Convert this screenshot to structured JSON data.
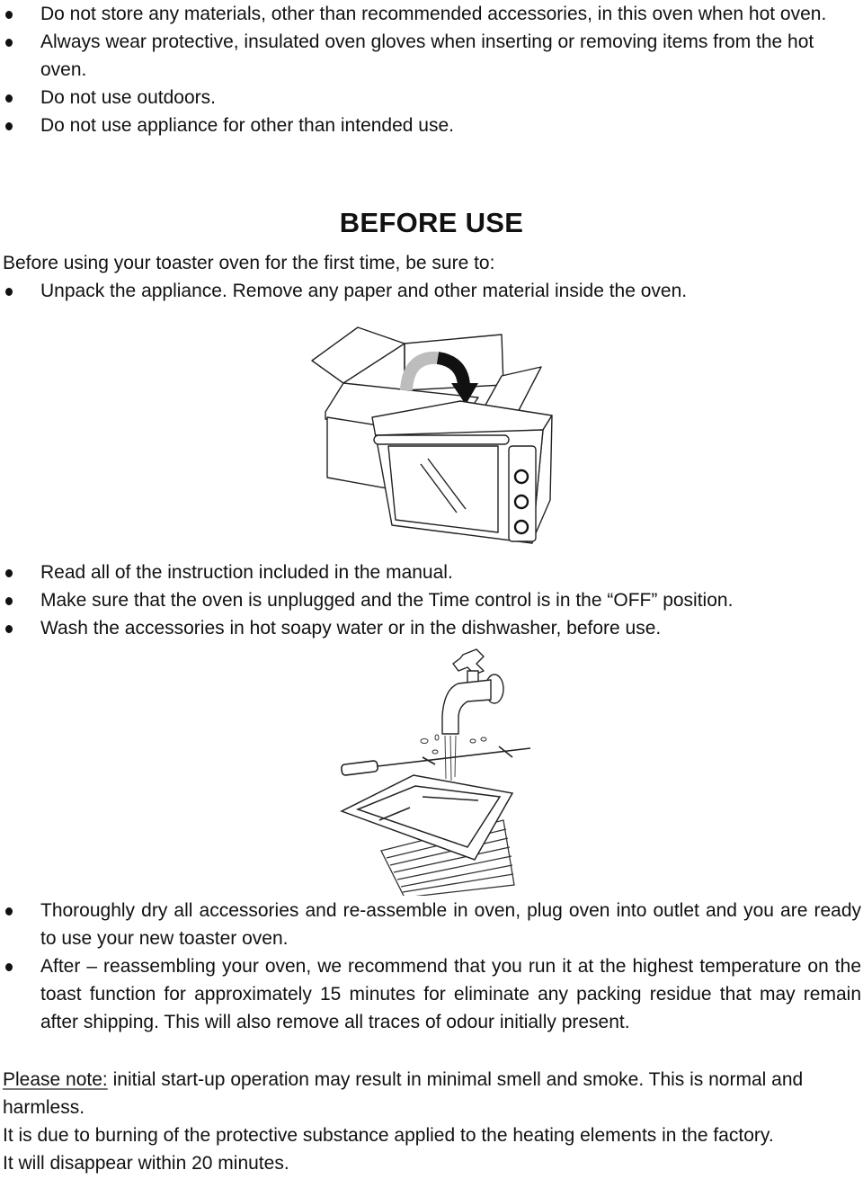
{
  "safety_bullets": [
    "Do not store any materials, other than recommended accessories, in this oven when hot oven.",
    "Always wear protective, insulated oven gloves when inserting or removing items from the hot oven.",
    "Do not use outdoors.",
    "Do not use appliance for other than intended use."
  ],
  "before_use": {
    "heading": "BEFORE USE",
    "intro": "Before using your toaster oven for the first time, be sure to:",
    "step_unpack": "Unpack the appliance. Remove any paper and other material inside the oven.",
    "figure_unpack": {
      "icon": "box-to-oven-illustration"
    },
    "steps_middle": [
      "Read all of the instruction included in the manual.",
      "Make sure that the oven is unplugged and the Time control is in the “OFF” position.",
      "Wash the accessories in hot soapy water or in the dishwasher, before use."
    ],
    "figure_wash": {
      "icon": "faucet-washing-accessories-illustration"
    },
    "steps_final": [
      "Thoroughly dry all accessories and re-assemble in oven, plug oven into outlet and you are ready to use your new toaster oven.",
      "After – reassembling your oven, we recommend that you run it at the highest temperature on the toast function for approximately 15 minutes for eliminate any packing residue that may remain after shipping. This will also remove all traces of odour initially present."
    ]
  },
  "notes": {
    "label": "Please note:",
    "line1": " initial start-up operation may result in minimal smell and smoke. This is normal and harmless.",
    "line2": "It is due to burning of the protective substance applied to the heating elements in the factory.",
    "line3": "It will disappear within 20 minutes."
  }
}
